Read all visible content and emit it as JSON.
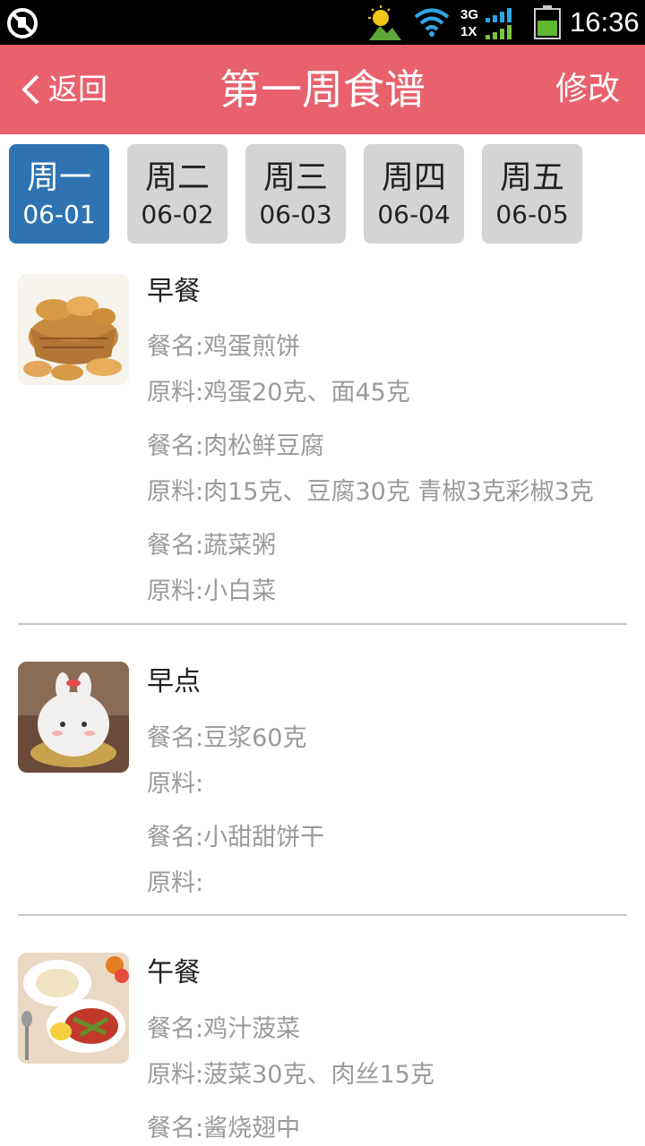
{
  "status_bar": {
    "time": "16:36",
    "net_type_top": "3G",
    "net_type_bottom": "1X",
    "icons": [
      "no-sim-icon",
      "weather-icon",
      "wifi-icon",
      "signal-icon",
      "battery-icon"
    ]
  },
  "header": {
    "back_label": "返回",
    "title": "第一周食谱",
    "edit_label": "修改",
    "bg_color": "#e8616c"
  },
  "day_tabs": [
    {
      "name": "周一",
      "date": "06-01",
      "active": true
    },
    {
      "name": "周二",
      "date": "06-02",
      "active": false
    },
    {
      "name": "周三",
      "date": "06-03",
      "active": false
    },
    {
      "name": "周四",
      "date": "06-04",
      "active": false
    },
    {
      "name": "周五",
      "date": "06-05",
      "active": false
    }
  ],
  "labels": {
    "dish": "餐名:",
    "ingredients": "原料:"
  },
  "meals": [
    {
      "type": "早餐",
      "image": "bread-basket-photo",
      "items": [
        {
          "dish": "鸡蛋煎饼",
          "ingredients": "鸡蛋20克、面45克"
        },
        {
          "dish": "肉松鲜豆腐",
          "ingredients": "肉15克、豆腐30克 青椒3克彩椒3克"
        },
        {
          "dish": "蔬菜粥",
          "ingredients": "小白菜"
        }
      ]
    },
    {
      "type": "早点",
      "image": "bunny-cake-photo",
      "items": [
        {
          "dish": "豆浆60克",
          "ingredients": ""
        },
        {
          "dish": "小甜甜饼干",
          "ingredients": ""
        }
      ]
    },
    {
      "type": "午餐",
      "image": "lunch-plate-photo",
      "items": [
        {
          "dish": "鸡汁菠菜",
          "ingredients": "菠菜30克、肉丝15克"
        },
        {
          "dish": "酱烧翅中",
          "ingredients": ""
        }
      ]
    }
  ],
  "colors": {
    "accent": "#e8616c",
    "tab_active": "#2f73b3",
    "tab_inactive": "#d4d4d4",
    "secondary_text": "#9a9a9a"
  }
}
